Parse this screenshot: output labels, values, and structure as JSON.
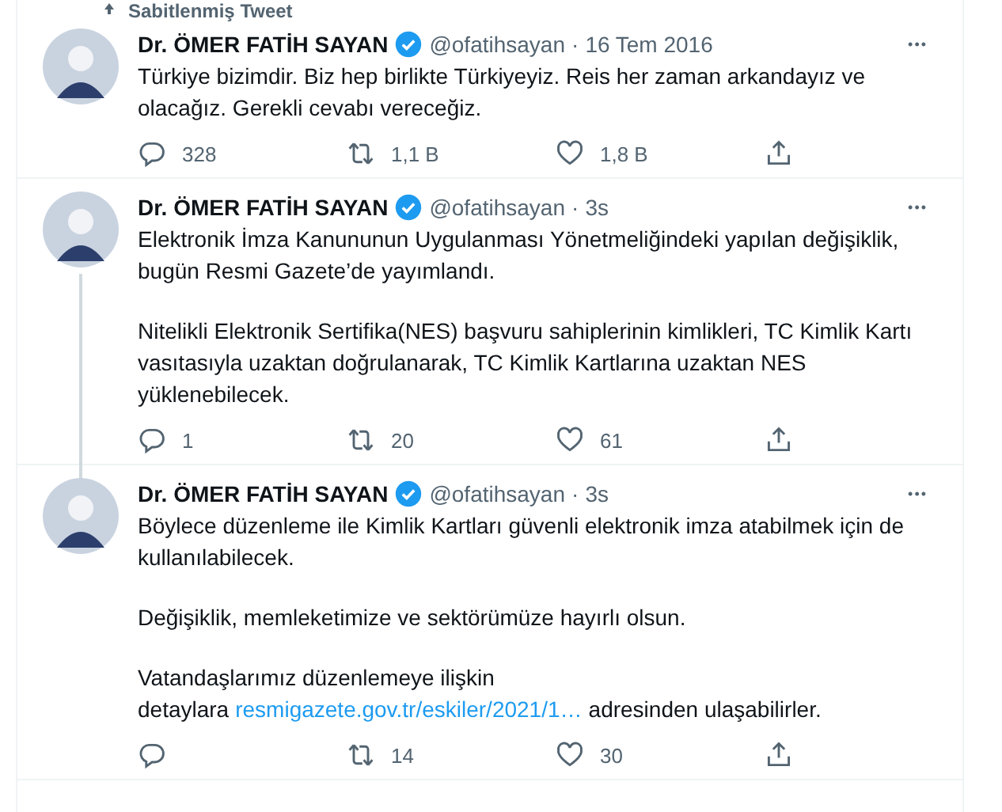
{
  "tweets": [
    {
      "pinned_label": "Sabitlenmiş Tweet",
      "name": "Dr. ÖMER FATİH SAYAN",
      "verified": true,
      "handle": "@ofatihsayan",
      "separator": "·",
      "time": "16 Tem 2016",
      "more": "•••",
      "paragraphs": [
        {
          "text": "Türkiye bizimdir. Biz hep birlikte Türkiyeyiz. Reis her zaman arkandayız ve olacağız. Gerekli cevabı vereceğiz."
        }
      ],
      "replies": "328",
      "retweets": "1,1 B",
      "likes": "1,8 B"
    },
    {
      "name": "Dr. ÖMER FATİH SAYAN",
      "verified": true,
      "handle": "@ofatihsayan",
      "separator": "·",
      "time": "3s",
      "thread_line": true,
      "more": "•••",
      "paragraphs": [
        {
          "text": "Elektronik İmza Kanununun Uygulanması Yönetmeliğindeki yapılan değişiklik, bugün Resmi Gazete’de yayımlandı."
        },
        {
          "text": "Nitelikli Elektronik Sertifika(NES) başvuru sahiplerinin kimlikleri, TC Kimlik Kartı vasıtasıyla uzaktan doğrulanarak, TC Kimlik Kartlarına uzaktan NES yüklenebilecek."
        }
      ],
      "replies": "1",
      "retweets": "20",
      "likes": "61"
    },
    {
      "name": "Dr. ÖMER FATİH SAYAN",
      "verified": true,
      "handle": "@ofatihsayan",
      "separator": "·",
      "time": "3s",
      "more": "•••",
      "paragraphs": [
        {
          "text": "Böylece düzenleme ile Kimlik Kartları güvenli elektronik imza atabilmek için de kullanılabilecek."
        },
        {
          "text": "Değişiklik, memleketimize ve sektörümüze hayırlı olsun."
        },
        {
          "text": "Vatandaşlarımız düzenlemeye ilişkin detaylara",
          "link": "resmigazete.gov.tr/eskiler/2021/1…",
          "text_after": "adresinden ulaşabilirler."
        }
      ],
      "retweets": "14",
      "likes": "30"
    }
  ]
}
